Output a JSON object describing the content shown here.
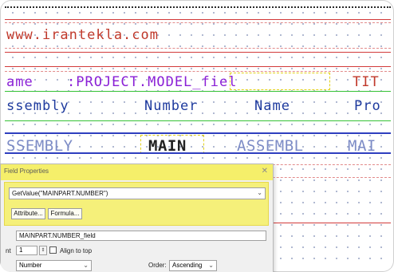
{
  "drawing": {
    "watermark": "www.irantekla.com",
    "row2": {
      "label": "ame",
      "value": ":PROJECT.MODEL_fiel",
      "right": "TIT"
    },
    "row3": {
      "col1": "ssembly",
      "col2": "Number",
      "col3": "Name",
      "col4": "Pro"
    },
    "row4": {
      "col1": "SSEMBLY",
      "main": "MAIN",
      "col3": "ASSEMBL",
      "col4": "MAI"
    }
  },
  "dialog": {
    "title": "Field Properties",
    "close_glyph": "✕",
    "expression": "GetValue(\"MAINPART.NUMBER\")",
    "attribute_button": "Attribute...",
    "formula_button": "Formula...",
    "field_name": "MAINPART.NUMBER_field",
    "row_label": "nt",
    "row_value": "1",
    "align_to_top": "Align to top",
    "type_value": "Number",
    "order_label": "Order:",
    "order_value": "Ascending"
  },
  "colors": {
    "highlight": "#f5ef6a",
    "red_line": "#d23a3a",
    "green_line": "#35c235",
    "blue_line": "#2e3fbf"
  }
}
